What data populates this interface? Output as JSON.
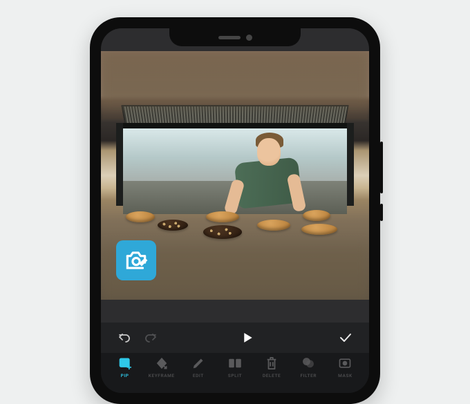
{
  "accent_color": "#2fc8e8",
  "overlay_badge": {
    "icon": "photo-eraser"
  },
  "transport": {
    "undo": {
      "enabled": true
    },
    "redo": {
      "enabled": false
    },
    "play": {
      "state": "paused"
    },
    "confirm": {
      "visible": true
    }
  },
  "toolbar": {
    "active_index": 0,
    "items": [
      {
        "id": "pip",
        "label": "PIP",
        "icon": "pip-icon"
      },
      {
        "id": "keyframe",
        "label": "KEYFRAME",
        "icon": "keyframe-icon"
      },
      {
        "id": "edit",
        "label": "EDIT",
        "icon": "edit-icon"
      },
      {
        "id": "split",
        "label": "SPLIT",
        "icon": "split-icon"
      },
      {
        "id": "delete",
        "label": "DELETE",
        "icon": "delete-icon"
      },
      {
        "id": "filter",
        "label": "FILTER",
        "icon": "filter-icon"
      },
      {
        "id": "mask",
        "label": "MASK",
        "icon": "mask-icon"
      }
    ]
  }
}
